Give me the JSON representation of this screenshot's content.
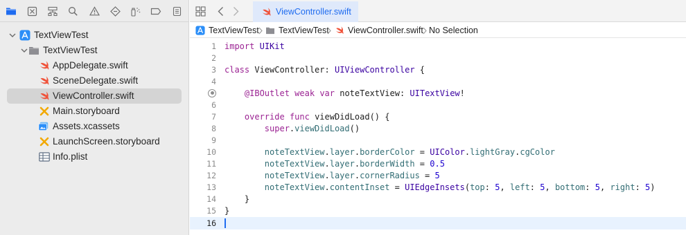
{
  "navigator": {
    "tools": [
      {
        "icon": "folder-icon"
      },
      {
        "icon": "source-control-icon"
      },
      {
        "icon": "symbol-hierarchy-icon"
      },
      {
        "icon": "find-icon"
      },
      {
        "icon": "warning-icon"
      },
      {
        "icon": "test-diamond-icon"
      },
      {
        "icon": "debug-spray-icon"
      },
      {
        "icon": "breakpoint-icon"
      },
      {
        "icon": "report-icon"
      }
    ],
    "tree": [
      {
        "label": "TextViewTest",
        "kind": "project",
        "depth": 0,
        "expanded": true
      },
      {
        "label": "TextViewTest",
        "kind": "group",
        "depth": 1,
        "expanded": true
      },
      {
        "label": "AppDelegate.swift",
        "kind": "swift",
        "depth": 2
      },
      {
        "label": "SceneDelegate.swift",
        "kind": "swift",
        "depth": 2
      },
      {
        "label": "ViewController.swift",
        "kind": "swift",
        "depth": 2,
        "selected": true
      },
      {
        "label": "Main.storyboard",
        "kind": "storyboard",
        "depth": 2
      },
      {
        "label": "Assets.xcassets",
        "kind": "assets",
        "depth": 2
      },
      {
        "label": "LaunchScreen.storyboard",
        "kind": "storyboard",
        "depth": 2
      },
      {
        "label": "Info.plist",
        "kind": "plist",
        "depth": 2
      }
    ]
  },
  "editor": {
    "active_tab": "ViewController.swift",
    "breadcrumb": [
      "TextViewTest",
      "TextViewTest",
      "ViewController.swift",
      "No Selection"
    ],
    "current_line": 16,
    "lines": [
      {
        "n": "1",
        "code": "import UIKit"
      },
      {
        "n": "2",
        "code": ""
      },
      {
        "n": "3",
        "code": "class ViewController: UIViewController {"
      },
      {
        "n": "4",
        "code": ""
      },
      {
        "n": "",
        "code": "    @IBOutlet weak var noteTextView: UITextView!"
      },
      {
        "n": "6",
        "code": ""
      },
      {
        "n": "7",
        "code": "    override func viewDidLoad() {"
      },
      {
        "n": "8",
        "code": "        super.viewDidLoad()"
      },
      {
        "n": "9",
        "code": ""
      },
      {
        "n": "10",
        "code": "        noteTextView.layer.borderColor = UIColor.lightGray.cgColor"
      },
      {
        "n": "11",
        "code": "        noteTextView.layer.borderWidth = 0.5"
      },
      {
        "n": "12",
        "code": "        noteTextView.layer.cornerRadius = 5"
      },
      {
        "n": "13",
        "code": "        noteTextView.contentInset = UIEdgeInsets(top: 5, left: 5, bottom: 5, right: 5)"
      },
      {
        "n": "14",
        "code": "    }"
      },
      {
        "n": "15",
        "code": "}"
      },
      {
        "n": "16",
        "code": ""
      }
    ]
  },
  "colors": {
    "accent": "#1f6cf0",
    "swift": "#f05138",
    "keyword": "#9b2393",
    "type": "#3900a0",
    "member": "#326d74",
    "number": "#1c00cf"
  }
}
